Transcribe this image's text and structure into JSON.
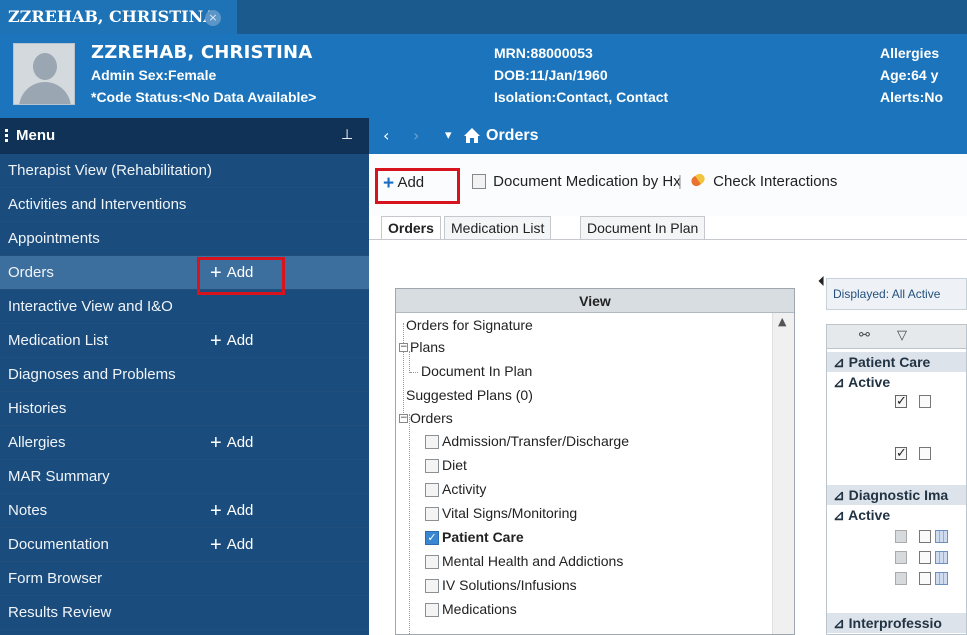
{
  "patient_tab": {
    "label": "ZZREHAB, CHRISTINA",
    "close_glyph": "×"
  },
  "banner": {
    "name": "ZZREHAB, CHRISTINA",
    "line1": "Admin Sex:Female",
    "line2": "*Code Status:<No Data Available>",
    "mrn": "MRN:88000053",
    "dob": "DOB:11/Jan/1960",
    "isolation": "Isolation:Contact, Contact",
    "allergies": "Allergies",
    "age": "Age:64 y",
    "alerts": "Alerts:No"
  },
  "menu": {
    "title": "Menu",
    "pin_glyph": "⊥",
    "add_label": "Add",
    "items": [
      {
        "label": "Therapist View (Rehabilitation)",
        "add": false
      },
      {
        "label": "Activities and Interventions",
        "add": false
      },
      {
        "label": "Appointments",
        "add": false
      },
      {
        "label": "Orders",
        "add": true,
        "selected": true
      },
      {
        "label": "Interactive View and I&O",
        "add": false
      },
      {
        "label": "Medication List",
        "add": true
      },
      {
        "label": "Diagnoses and Problems",
        "add": false
      },
      {
        "label": "Histories",
        "add": false
      },
      {
        "label": "Allergies",
        "add": true
      },
      {
        "label": "MAR Summary",
        "add": false
      },
      {
        "label": "Notes",
        "add": true
      },
      {
        "label": "Documentation",
        "add": true
      },
      {
        "label": "Form Browser",
        "add": false
      },
      {
        "label": "Results Review",
        "add": false
      }
    ]
  },
  "navbar": {
    "back": "‹",
    "forward": "›",
    "dropdown": "▾",
    "title": "Orders"
  },
  "toolbar": {
    "add_label": "Add",
    "doc_med_label": "Document Medication by Hx",
    "separator": "|",
    "check_interactions_label": "Check Interactions"
  },
  "tabs": [
    "Orders",
    "Medication List",
    "Document In Plan"
  ],
  "tree": {
    "header": "View",
    "collapse_glyph": "⏴",
    "nodes": {
      "orders_for_signature": "Orders for Signature",
      "plans": "Plans",
      "document_in_plan": "Document In Plan",
      "suggested_plans": "Suggested Plans (0)",
      "orders": "Orders",
      "categories": [
        {
          "label": "Admission/Transfer/Discharge",
          "checked": false
        },
        {
          "label": "Diet",
          "checked": false
        },
        {
          "label": "Activity",
          "checked": false
        },
        {
          "label": "Vital Signs/Monitoring",
          "checked": false
        },
        {
          "label": "Patient Care",
          "checked": true
        },
        {
          "label": "Mental Health and Addictions",
          "checked": false
        },
        {
          "label": "IV Solutions/Infusions",
          "checked": false
        },
        {
          "label": "Medications",
          "checked": false
        }
      ]
    }
  },
  "right_pane": {
    "displayed_label": "Displayed: All Active",
    "groups": {
      "patient_care": "Patient Care",
      "active1": "Active",
      "diagnostic": "Diagnostic Ima",
      "active2": "Active",
      "interprofessional": "Interprofessio"
    },
    "collapse_glyph": "⊿"
  },
  "colors": {
    "banner_blue": "#1c75bc",
    "menu_dark": "#0f3256",
    "sidebar_blue": "#1a4d7e",
    "highlight_red": "#d7141e"
  }
}
